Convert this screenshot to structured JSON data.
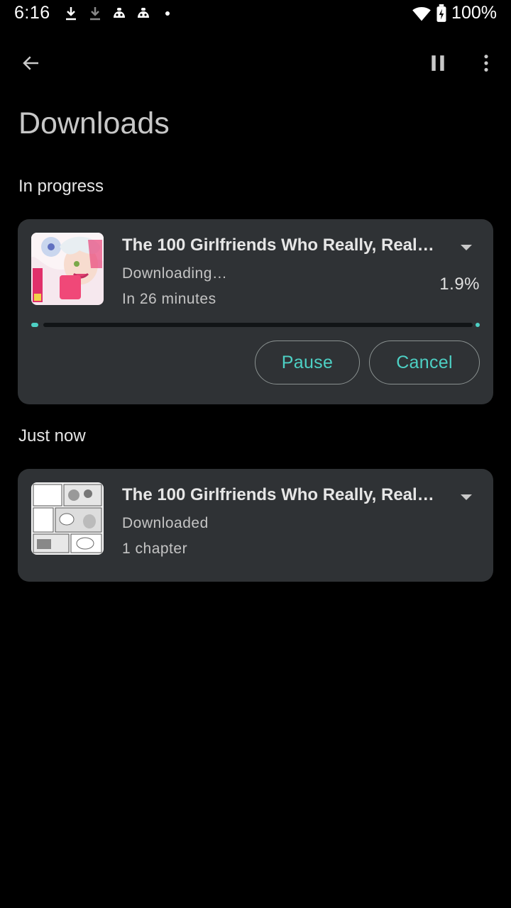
{
  "status_bar": {
    "time": "6:16",
    "battery_text": "100%",
    "icons": [
      "download-icon",
      "download-icon",
      "game-controller-icon",
      "game-controller-icon",
      "dot-icon",
      "wifi-icon",
      "battery-icon"
    ]
  },
  "app_bar": {
    "back_icon": "arrow-left-icon",
    "pause_all_icon": "pause-icon",
    "more_icon": "more-vertical-icon"
  },
  "page": {
    "title": "Downloads"
  },
  "sections": [
    {
      "label": "In progress",
      "item": {
        "title": "The 100 Girlfriends Who Really, Reall…",
        "status": "Downloading…",
        "eta": "In 26 minutes",
        "percent_text": "1.9%",
        "progress": 0.019,
        "pause_label": "Pause",
        "cancel_label": "Cancel"
      }
    },
    {
      "label": "Just now",
      "item": {
        "title": "The 100 Girlfriends Who Really, Reall…",
        "status": "Downloaded",
        "detail": "1 chapter"
      }
    }
  ],
  "colors": {
    "background": "#000000",
    "card": "#2f3235",
    "accent": "#4dd0c4",
    "text_primary": "#e6e6e6",
    "text_secondary": "#c4c4c4"
  }
}
